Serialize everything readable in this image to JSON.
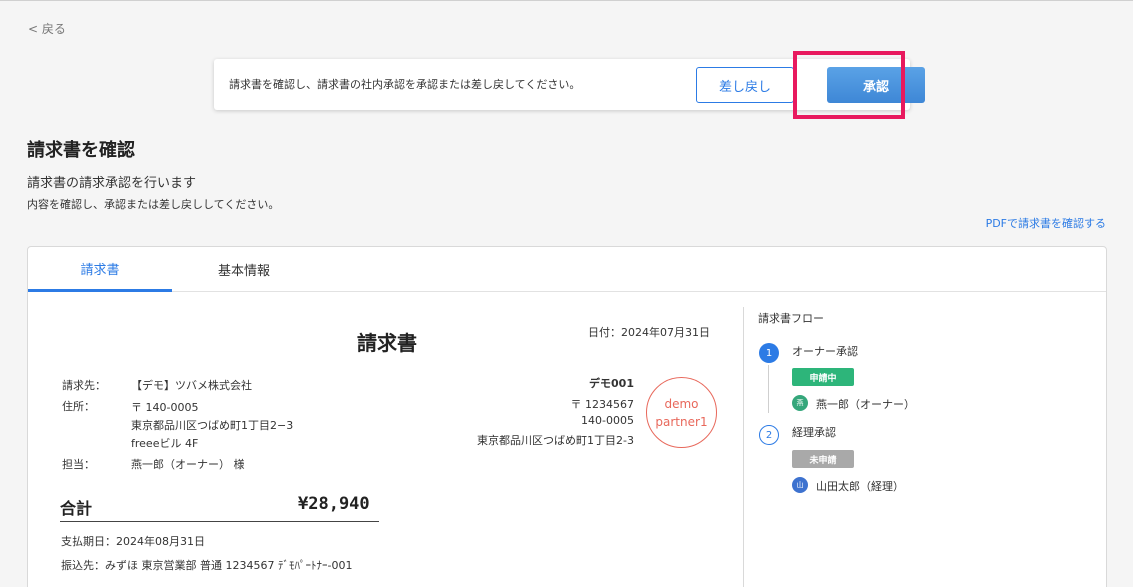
{
  "nav": {
    "back_label": "< 戻る"
  },
  "action_bar": {
    "message": "請求書を確認し、請求書の社内承認を承認または差し戻してください。",
    "return_label": "差し戻し",
    "approve_label": "承認"
  },
  "header": {
    "title": "請求書を確認",
    "subtitle": "請求書の請求承認を行います",
    "description": "内容を確認し、承認または差し戻ししてください。",
    "pdf_link": "PDFで請求書を確認する"
  },
  "tabs": [
    {
      "label": "請求書",
      "active": true
    },
    {
      "label": "基本情報",
      "active": false
    }
  ],
  "invoice": {
    "title": "請求書",
    "date": "日付：2024年07月31日",
    "recipient_label": "請求先：",
    "recipient_value": "【デモ】ツバメ株式会社",
    "address_label": "住所：",
    "address_lines": [
      "〒 140-0005",
      "東京都品川区つばめ町1丁目2−3",
      "freeeビル 4F"
    ],
    "contact_label": "担当：",
    "contact_value": "燕一郎（オーナー） 様",
    "sender_name": "デモ001",
    "sender_lines": [
      "〒 1234567",
      "140-0005",
      "東京都品川区つばめ町1丁目2-3"
    ],
    "stamp_lines": [
      "demo",
      "partner1"
    ],
    "total_label": "合計",
    "total_value": "¥28,940",
    "due_date": "支払期日：2024年08月31日",
    "bank": "振込先：みずほ 東京営業部 普通 1234567 ﾃﾞﾓﾊﾟｰﾄﾅｰ-001"
  },
  "flow": {
    "title": "請求書フロー",
    "steps": [
      {
        "number": "1",
        "label": "オーナー承認",
        "status": "申請中",
        "avatar": "燕",
        "person": "燕一郎（オーナー）"
      },
      {
        "number": "2",
        "label": "経理承認",
        "status": "未申請",
        "avatar": "山",
        "person": "山田太郎（経理）"
      }
    ]
  },
  "colors": {
    "accent": "#2c7be5",
    "highlight": "#e8195e",
    "status_in_progress": "#2db57a",
    "status_not_applied": "#a9a9a9",
    "stamp": "#e8685b"
  }
}
